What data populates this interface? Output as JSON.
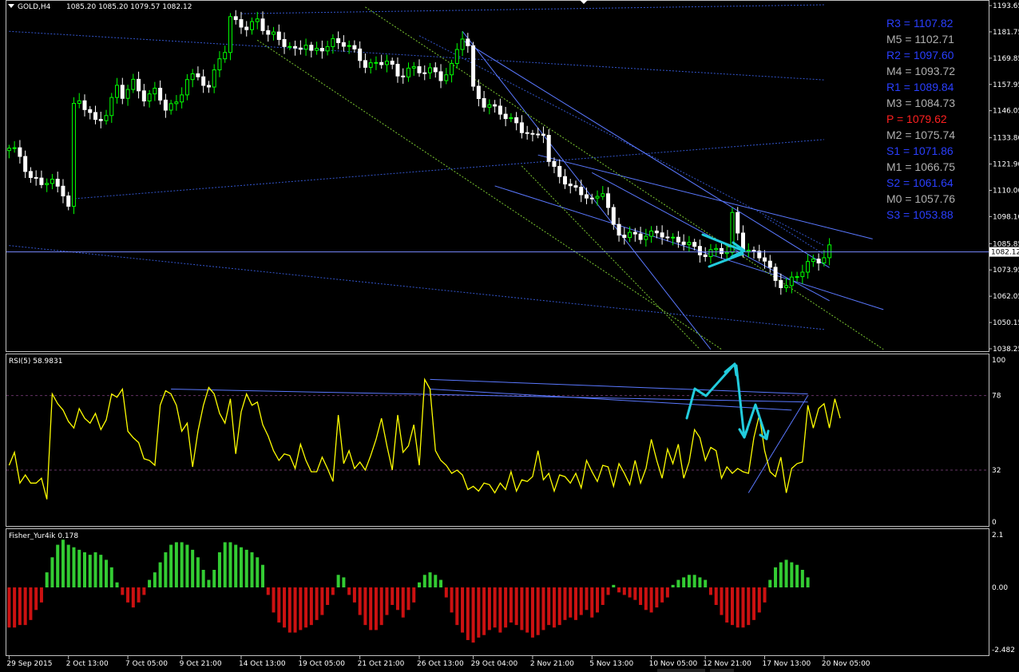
{
  "window": {
    "symbol_title": "GOLD,H4",
    "ohlc": "1085.20 1085.20 1079.57 1082.12"
  },
  "colors": {
    "background": "#000000",
    "candle_up": "#00ff00",
    "candle_down": "#ffffff",
    "trend": "#5a78ff",
    "support_dotted": "#3355cc",
    "channel_green": "#7cc832",
    "rsi_line": "#ffff00",
    "rsi_level": "#663366",
    "fisher_pos": "#33cc33",
    "fisher_neg": "#cc1111",
    "arrow": "#22ccdd",
    "pivot_blue": "#2a3fff",
    "pivot_gray": "#b0b0b0",
    "pivot_red": "#ff2020",
    "price_line": "#7788ff"
  },
  "chart_data": [
    {
      "type": "candlestick",
      "pane": "price",
      "title": "GOLD,H4",
      "y_ticks": [
        1193.65,
        1181.75,
        1169.85,
        1157.95,
        1146.05,
        1133.8,
        1121.9,
        1110.0,
        1098.1,
        1085.85,
        1073.95,
        1062.05,
        1050.15,
        1038.25
      ],
      "ylim": [
        1038.25,
        1193.65
      ],
      "current_price": "1082.12",
      "close_path": [
        [
          0,
          1128
        ],
        [
          2,
          1126
        ],
        [
          4,
          1116
        ],
        [
          6,
          1113
        ],
        [
          8,
          1113
        ],
        [
          10,
          1110
        ],
        [
          11,
          1104
        ],
        [
          12,
          1148
        ],
        [
          13,
          1150
        ],
        [
          16,
          1141
        ],
        [
          18,
          1146
        ],
        [
          20,
          1156
        ],
        [
          21,
          1152
        ],
        [
          23,
          1159
        ],
        [
          25,
          1153
        ],
        [
          27,
          1154
        ],
        [
          29,
          1147
        ],
        [
          31,
          1150
        ],
        [
          33,
          1161
        ],
        [
          35,
          1160
        ],
        [
          37,
          1157
        ],
        [
          39,
          1171
        ],
        [
          40,
          1174
        ],
        [
          41,
          1187
        ],
        [
          42,
          1185
        ],
        [
          44,
          1184
        ],
        [
          46,
          1188
        ],
        [
          48,
          1180
        ],
        [
          51,
          1177
        ],
        [
          53,
          1174
        ],
        [
          55,
          1176
        ],
        [
          56,
          1171
        ],
        [
          58,
          1175
        ],
        [
          60,
          1178
        ],
        [
          62,
          1176
        ],
        [
          64,
          1172
        ],
        [
          66,
          1168
        ],
        [
          68,
          1167
        ],
        [
          70,
          1168
        ],
        [
          72,
          1162
        ],
        [
          74,
          1166
        ],
        [
          76,
          1163
        ],
        [
          78,
          1164
        ],
        [
          80,
          1162
        ],
        [
          82,
          1166
        ],
        [
          84,
          1179
        ],
        [
          85,
          1175
        ],
        [
          86,
          1156
        ],
        [
          88,
          1150
        ],
        [
          90,
          1146
        ],
        [
          92,
          1143
        ],
        [
          94,
          1141
        ],
        [
          96,
          1136
        ],
        [
          97,
          1133
        ],
        [
          99,
          1136
        ],
        [
          100,
          1123
        ],
        [
          102,
          1118
        ],
        [
          104,
          1110
        ],
        [
          106,
          1109
        ],
        [
          108,
          1106
        ],
        [
          110,
          1110
        ],
        [
          112,
          1092
        ],
        [
          113,
          1090
        ],
        [
          115,
          1091
        ],
        [
          117,
          1089
        ],
        [
          119,
          1089
        ],
        [
          121,
          1091
        ],
        [
          123,
          1088
        ],
        [
          125,
          1086
        ],
        [
          127,
          1083
        ],
        [
          129,
          1082
        ],
        [
          131,
          1083
        ],
        [
          133,
          1081
        ],
        [
          134,
          1098
        ],
        [
          136,
          1085
        ],
        [
          138,
          1081
        ],
        [
          140,
          1078
        ],
        [
          142,
          1069
        ],
        [
          144,
          1068
        ],
        [
          146,
          1070
        ],
        [
          148,
          1077
        ],
        [
          150,
          1079
        ],
        [
          152,
          1084
        ]
      ],
      "trendlines": [
        {
          "from": [
            "2 Oct 13:00",
            1106
          ],
          "to": [
            "20 Nov 05:00",
            1133
          ]
        },
        {
          "from": [
            "29 Sep 2015",
            1182
          ],
          "to": [
            "20 Nov 05:00",
            1160
          ]
        },
        {
          "from": [
            "14 Oct 13:00",
            1190
          ],
          "to": [
            "20 Nov 05:00",
            1194
          ]
        },
        {
          "from": [
            "29 Sep 2015",
            1085
          ],
          "to": [
            "20 Nov 05:00",
            1047
          ]
        },
        {
          "from": [
            "26 Oct 13:00",
            1180
          ],
          "to": [
            "20 Nov 05:00",
            1085
          ]
        },
        {
          "from": [
            "17 Nov 13:00",
            1098
          ],
          "to": [
            "20 Nov 05:00",
            1081
          ]
        }
      ],
      "pivots": [
        {
          "label": "R3",
          "value": "1107.82",
          "color": "blue"
        },
        {
          "label": "M5",
          "value": "1102.71",
          "color": "gray"
        },
        {
          "label": "R2",
          "value": "1097.60",
          "color": "blue"
        },
        {
          "label": "M4",
          "value": "1093.72",
          "color": "gray"
        },
        {
          "label": "R1",
          "value": "1089.84",
          "color": "blue"
        },
        {
          "label": "M3",
          "value": "1084.73",
          "color": "gray"
        },
        {
          "label": "P",
          "value": "1079.62",
          "color": "red"
        },
        {
          "label": "M2",
          "value": "1075.74",
          "color": "gray"
        },
        {
          "label": "S1",
          "value": "1071.86",
          "color": "blue"
        },
        {
          "label": "M1",
          "value": "1066.75",
          "color": "gray"
        },
        {
          "label": "S2",
          "value": "1061.64",
          "color": "blue"
        },
        {
          "label": "M0",
          "value": "1057.76",
          "color": "gray"
        },
        {
          "label": "S3",
          "value": "1053.88",
          "color": "blue"
        }
      ]
    },
    {
      "type": "line",
      "pane": "rsi",
      "title": "RSI(5) 58.9831",
      "y_ticks": [
        100,
        78,
        32,
        0
      ],
      "ylim": [
        0,
        100
      ],
      "levels": [
        78,
        32
      ],
      "values": [
        35,
        43,
        24,
        29,
        24,
        24,
        27,
        14,
        79,
        73,
        69,
        62,
        58,
        70,
        64,
        61,
        67,
        57,
        63,
        79,
        77,
        82,
        56,
        52,
        49,
        39,
        38,
        35,
        72,
        81,
        79,
        72,
        56,
        61,
        34,
        56,
        72,
        83,
        79,
        67,
        61,
        76,
        42,
        68,
        79,
        72,
        74,
        60,
        53,
        44,
        38,
        42,
        41,
        33,
        48,
        38,
        31,
        31,
        40,
        33,
        25,
        66,
        36,
        44,
        33,
        37,
        32,
        41,
        51,
        64,
        47,
        32,
        66,
        43,
        47,
        60,
        35,
        88,
        82,
        44,
        38,
        35,
        30,
        32,
        29,
        20,
        22,
        19,
        24,
        23,
        18,
        24,
        20,
        31,
        19,
        26,
        25,
        28,
        44,
        26,
        30,
        19,
        29,
        28,
        24,
        30,
        21,
        38,
        31,
        25,
        35,
        34,
        22,
        36,
        30,
        23,
        38,
        24,
        33,
        51,
        38,
        27,
        45,
        36,
        48,
        27,
        37,
        57,
        52,
        38,
        46,
        44,
        27,
        34,
        30,
        33,
        31,
        30,
        52,
        66,
        44,
        31,
        28,
        40,
        18,
        33,
        36,
        37,
        72,
        58,
        70,
        73,
        58,
        76,
        64
      ]
    },
    {
      "type": "bar",
      "pane": "fisher",
      "title": "Fisher_Yur4ik 0.178",
      "y_ticks": [
        2.1,
        0.0,
        -2.482
      ],
      "ylim": [
        -2.482,
        2.1
      ],
      "values": [
        -1.6,
        -1.6,
        -1.5,
        -1.5,
        -1.3,
        -0.9,
        -0.6,
        0.6,
        1.2,
        1.7,
        1.9,
        1.7,
        1.6,
        1.5,
        1.4,
        1.3,
        1.4,
        1.3,
        1.1,
        0.8,
        0.2,
        -0.3,
        -0.6,
        -0.8,
        -0.6,
        -0.3,
        0.3,
        0.6,
        1.0,
        1.4,
        1.7,
        1.8,
        1.8,
        1.7,
        1.5,
        1.2,
        0.7,
        0.3,
        0.7,
        1.4,
        1.8,
        1.8,
        1.7,
        1.6,
        1.5,
        1.4,
        1.2,
        0.9,
        -0.3,
        -1.0,
        -1.4,
        -1.6,
        -1.8,
        -1.8,
        -1.7,
        -1.6,
        -1.5,
        -1.3,
        -1.1,
        -0.7,
        -0.3,
        0.5,
        0.4,
        -0.3,
        -0.6,
        -1.1,
        -1.5,
        -1.7,
        -1.7,
        -1.5,
        -1.1,
        -0.7,
        -0.9,
        -1.2,
        -0.9,
        -0.6,
        0.2,
        0.5,
        0.6,
        0.5,
        0.3,
        -0.4,
        -1.0,
        -1.5,
        -1.8,
        -2.1,
        -2.2,
        -2.0,
        -1.9,
        -1.7,
        -1.6,
        -1.8,
        -1.6,
        -1.4,
        -1.5,
        -1.7,
        -1.8,
        -2.0,
        -1.9,
        -1.7,
        -1.5,
        -1.6,
        -1.5,
        -1.3,
        -1.2,
        -1.3,
        -1.1,
        -0.9,
        -1.2,
        -1.0,
        -0.7,
        -0.3,
        0.1,
        -0.2,
        -0.3,
        -0.4,
        -0.5,
        -0.7,
        -0.9,
        -1.0,
        -0.8,
        -0.6,
        -0.4,
        0.1,
        0.3,
        0.4,
        0.5,
        0.5,
        0.4,
        0.3,
        -0.3,
        -0.7,
        -1.1,
        -1.4,
        -1.5,
        -1.6,
        -1.6,
        -1.5,
        -1.3,
        -1.0,
        -0.6,
        0.3,
        0.8,
        1.0,
        1.1,
        1.0,
        0.9,
        0.7,
        0.4
      ]
    }
  ],
  "x_axis": {
    "labels": [
      "29 Sep 2015",
      "2 Oct 13:00",
      "7 Oct 05:00",
      "9 Oct 21:00",
      "14 Oct 13:00",
      "19 Oct 05:00",
      "21 Oct 21:00",
      "26 Oct 13:00",
      "29 Oct 04:00",
      "2 Nov 21:00",
      "5 Nov 13:00",
      "10 Nov 05:00",
      "12 Nov 21:00",
      "17 Nov 13:00",
      "20 Nov 05:00"
    ]
  }
}
